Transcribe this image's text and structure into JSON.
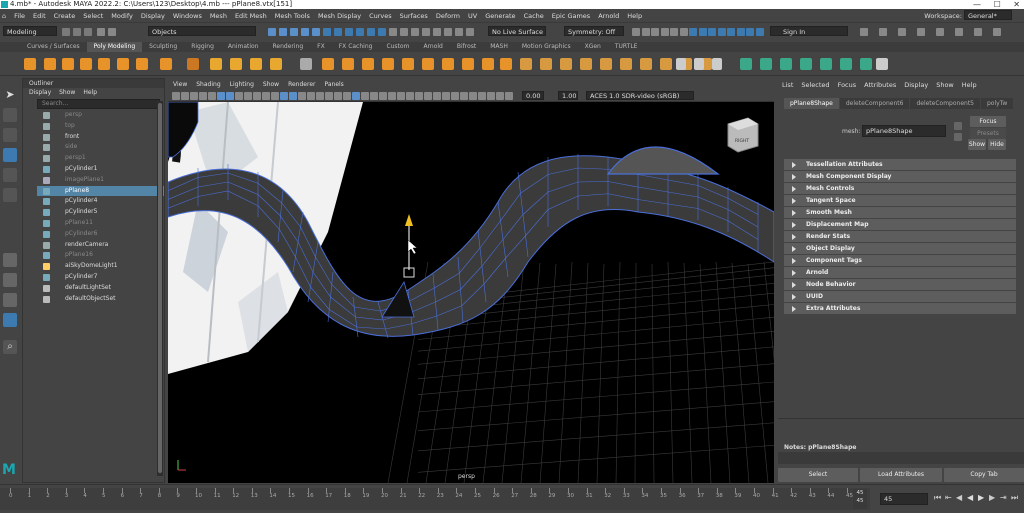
{
  "window": {
    "title": "4.mb* - Autodesk MAYA 2022.2: C:\\Users\\123\\Desktop\\4.mb --- pPlane8.vtx[151]",
    "min": "—",
    "max": "☐",
    "close": "✕"
  },
  "menubar": [
    "File",
    "Edit",
    "Create",
    "Select",
    "Modify",
    "Display",
    "Windows",
    "Mesh",
    "Edit Mesh",
    "Mesh Tools",
    "Mesh Display",
    "Curves",
    "Surfaces",
    "Deform",
    "UV",
    "Generate",
    "Cache",
    "Epic Games",
    "Arnold",
    "Help"
  ],
  "workspace": {
    "label": "Workspace:",
    "value": "General*"
  },
  "statusline": {
    "menuset": "Modeling",
    "select_mode": "Objects",
    "live_surface": "No Live Surface",
    "symmetry": "Symmetry: Off",
    "sign_in": "Sign In"
  },
  "shelf_tabs": [
    "Curves / Surfaces",
    "Poly Modeling",
    "Sculpting",
    "Rigging",
    "Animation",
    "Rendering",
    "FX",
    "FX Caching",
    "Custom",
    "Arnold",
    "Bifrost",
    "MASH",
    "Motion Graphics",
    "XGen",
    "TURTLE"
  ],
  "outliner": {
    "title": "Outliner",
    "menu": [
      "Display",
      "Show",
      "Help"
    ],
    "search_placeholder": "Search...",
    "items": [
      {
        "label": "persp",
        "dim": true,
        "icon": "camera-icon"
      },
      {
        "label": "top",
        "dim": true,
        "icon": "camera-icon"
      },
      {
        "label": "front",
        "dim": false,
        "icon": "camera-icon"
      },
      {
        "label": "side",
        "dim": true,
        "icon": "camera-icon"
      },
      {
        "label": "persp1",
        "dim": true,
        "icon": "camera-icon"
      },
      {
        "label": "pCylinder1",
        "dim": false,
        "icon": "mesh-icon"
      },
      {
        "label": "imagePlane1",
        "dim": true,
        "icon": "image-plane-icon"
      },
      {
        "label": "pPlane8",
        "dim": false,
        "icon": "mesh-icon",
        "selected": true
      },
      {
        "label": "pCylinder4",
        "dim": false,
        "icon": "mesh-icon"
      },
      {
        "label": "pCylinder5",
        "dim": false,
        "icon": "mesh-icon"
      },
      {
        "label": "pPlane11",
        "dim": true,
        "icon": "mesh-icon"
      },
      {
        "label": "pCylinder6",
        "dim": true,
        "icon": "mesh-icon"
      },
      {
        "label": "renderCamera",
        "dim": false,
        "icon": "camera-icon"
      },
      {
        "label": "pPlane16",
        "dim": true,
        "icon": "mesh-icon"
      },
      {
        "label": "aiSkyDomeLight1",
        "dim": false,
        "icon": "light-icon"
      },
      {
        "label": "pCylinder7",
        "dim": false,
        "icon": "mesh-icon"
      },
      {
        "label": "defaultLightSet",
        "dim": false,
        "icon": "set-icon"
      },
      {
        "label": "defaultObjectSet",
        "dim": false,
        "icon": "set-icon"
      }
    ]
  },
  "viewport": {
    "menu": [
      "View",
      "Shading",
      "Lighting",
      "Show",
      "Renderer",
      "Panels"
    ],
    "exposure": "0.00",
    "gamma": "1.00",
    "colorspace": "ACES 1.0 SDR-video (sRGB)",
    "camera_label": "persp",
    "cube_label": "RIGHT"
  },
  "attribute_editor": {
    "menu": [
      "List",
      "Selected",
      "Focus",
      "Attributes",
      "Display",
      "Show",
      "Help"
    ],
    "tabs": [
      "pPlane8Shape",
      "deleteComponent6",
      "deleteComponent5",
      "polyTw"
    ],
    "mesh_label": "mesh:",
    "mesh_value": "pPlane8Shape",
    "focus": "Focus",
    "presets": "Presets",
    "show": "Show",
    "hide": "Hide",
    "sections": [
      "Tessellation Attributes",
      "Mesh Component Display",
      "Mesh Controls",
      "Tangent Space",
      "Smooth Mesh",
      "Displacement Map",
      "Render Stats",
      "Object Display",
      "Component Tags",
      "Arnold",
      "Node Behavior",
      "UUID",
      "Extra Attributes"
    ],
    "notes": "Notes:  pPlane8Shape",
    "buttons": [
      "Select",
      "Load Attributes",
      "Copy Tab"
    ]
  },
  "timeline": {
    "ticks": [
      "0",
      "1",
      "2",
      "3",
      "4",
      "5",
      "6",
      "7",
      "8",
      "9",
      "10",
      "11",
      "12",
      "13",
      "14",
      "15",
      "16",
      "17",
      "18",
      "19",
      "20",
      "21",
      "22",
      "23",
      "24",
      "25",
      "26",
      "27",
      "28",
      "29",
      "30",
      "31",
      "32",
      "33",
      "34",
      "35",
      "36",
      "37",
      "38",
      "39",
      "40",
      "41",
      "42",
      "43",
      "44",
      "45"
    ],
    "current_marker": "45",
    "end_field": "45",
    "current_frame": "45",
    "frame_field": "45"
  },
  "colors": {
    "accent": "#5285a6",
    "wire": "#4a6fd8",
    "bg": "#444444"
  }
}
